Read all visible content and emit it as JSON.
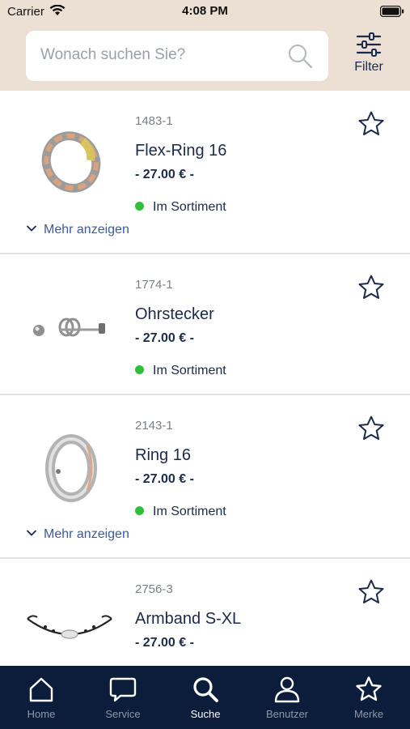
{
  "status_bar": {
    "carrier": "Carrier",
    "time": "4:08 PM"
  },
  "search": {
    "placeholder": "Wonach suchen Sie?"
  },
  "filter": {
    "label": "Filter"
  },
  "products": [
    {
      "sku": "1483-1",
      "name": "Flex-Ring 16",
      "price": "- 27.00 € -",
      "availability": "Im Sortiment",
      "more": "Mehr anzeigen"
    },
    {
      "sku": "1774-1",
      "name": "Ohrstecker",
      "price": "- 27.00 € -",
      "availability": "Im Sortiment"
    },
    {
      "sku": "2143-1",
      "name": "Ring 16",
      "price": "- 27.00 € -",
      "availability": "Im Sortiment",
      "more": "Mehr anzeigen"
    },
    {
      "sku": "2756-3",
      "name": "Armband S-XL",
      "price": "- 27.00 € -"
    }
  ],
  "tabs": [
    {
      "label": "Home",
      "icon": "home-icon"
    },
    {
      "label": "Service",
      "icon": "chat-icon"
    },
    {
      "label": "Suche",
      "icon": "search-icon",
      "active": true
    },
    {
      "label": "Benutzer",
      "icon": "user-icon"
    },
    {
      "label": "Merke",
      "icon": "star-icon"
    }
  ],
  "colors": {
    "header_bg": "#ecdfd3",
    "navy": "#1b2a4a",
    "tabbar_bg": "#0b1d3a",
    "in_stock": "#2fbf3a",
    "link": "#3c5a99"
  }
}
